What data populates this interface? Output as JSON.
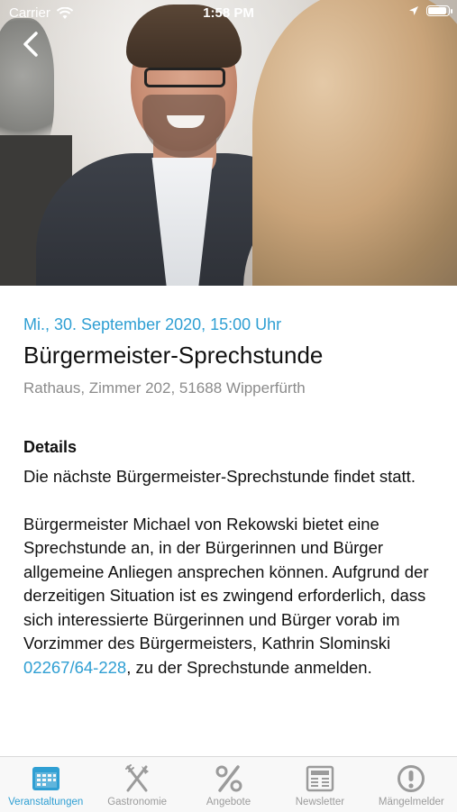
{
  "status_bar": {
    "carrier": "Carrier",
    "time": "1:58 PM",
    "icons": [
      "wifi-icon",
      "location-arrow-icon",
      "battery-icon"
    ],
    "battery_fill_fraction": 0.9
  },
  "navigation": {
    "back_icon": "chevron-left-icon"
  },
  "event": {
    "date": "Mi., 30. September 2020, 15:00 Uhr",
    "title": "Bürgermeister-Sprechstunde",
    "location": "Rathaus, Zimmer 202, 51688 Wipperfürth",
    "details_heading": "Details",
    "paragraph1": "Die nächste Bürgermeister-Sprechstunde findet statt.",
    "paragraph2_text": "Bürgermeister Michael von Rekowski bietet eine Sprechstunde an, in der Bürgerinnen und Bürger allgemeine Anliegen ansprechen können. Aufgrund der derzeitigen Situation ist es zwingend erforderlich, dass sich interessierte Bürgerinnen und Bürger vorab im Vorzimmer des Bürgermeisters, Kathrin Slominski ",
    "phone": "02267/64-228",
    "paragraph2_end": ", zu der Sprechstunde anmelden."
  },
  "tabbar": {
    "active_index": 0,
    "tabs": [
      {
        "label": "Veranstaltungen",
        "icon": "calendar-icon"
      },
      {
        "label": "Gastronomie",
        "icon": "fork-knife-icon"
      },
      {
        "label": "Angebote",
        "icon": "percent-icon"
      },
      {
        "label": "Newsletter",
        "icon": "newspaper-icon"
      },
      {
        "label": "Mängelmelder",
        "icon": "exclamation-circle-icon"
      }
    ]
  },
  "colors": {
    "accent": "#2f9fd3",
    "secondary_text": "#8b8b8b",
    "inactive_tab": "#9b9b9b"
  }
}
